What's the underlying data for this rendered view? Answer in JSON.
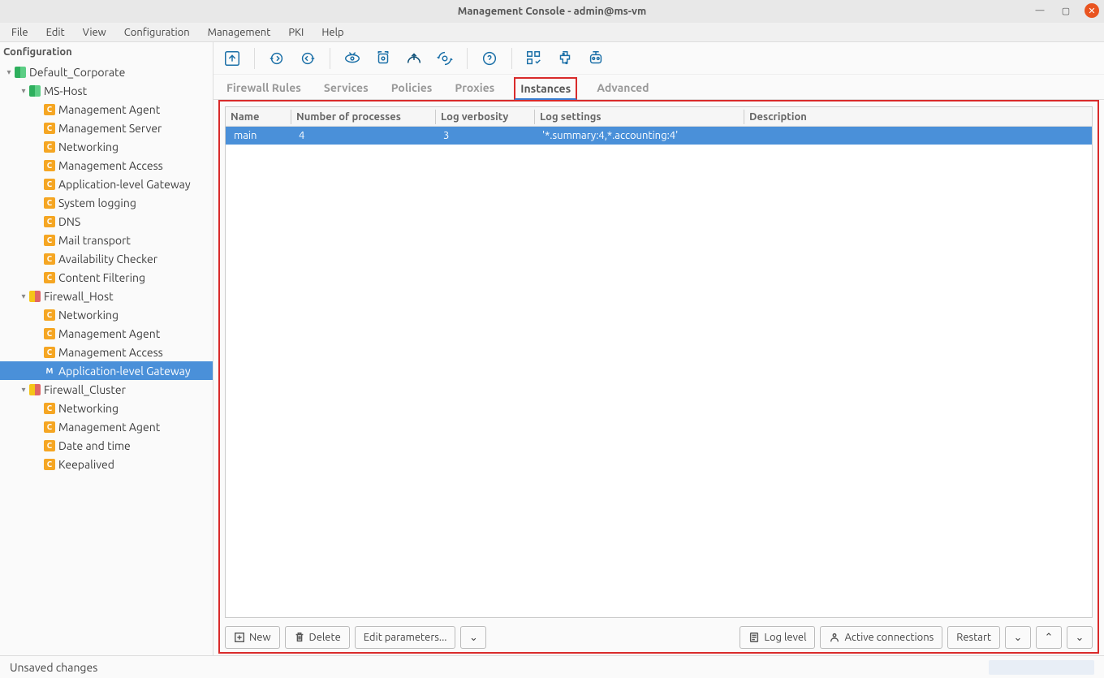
{
  "window": {
    "title": "Management Console - admin@ms-vm"
  },
  "menu": [
    "File",
    "Edit",
    "View",
    "Configuration",
    "Management",
    "PKI",
    "Help"
  ],
  "sidebar": {
    "title": "Configuration",
    "tree": [
      {
        "depth": 0,
        "caret": "▾",
        "icon": "dual-green",
        "label": "Default_Corporate"
      },
      {
        "depth": 1,
        "caret": "▾",
        "icon": "dual-green2",
        "label": "MS-Host"
      },
      {
        "depth": 2,
        "caret": "",
        "icon": "c",
        "label": "Management Agent"
      },
      {
        "depth": 2,
        "caret": "",
        "icon": "c",
        "label": "Management Server"
      },
      {
        "depth": 2,
        "caret": "",
        "icon": "c",
        "label": "Networking"
      },
      {
        "depth": 2,
        "caret": "",
        "icon": "c",
        "label": "Management Access"
      },
      {
        "depth": 2,
        "caret": "",
        "icon": "c",
        "label": "Application-level Gateway"
      },
      {
        "depth": 2,
        "caret": "",
        "icon": "c",
        "label": "System logging"
      },
      {
        "depth": 2,
        "caret": "",
        "icon": "c",
        "label": "DNS"
      },
      {
        "depth": 2,
        "caret": "",
        "icon": "c",
        "label": "Mail transport"
      },
      {
        "depth": 2,
        "caret": "",
        "icon": "c",
        "label": "Availability Checker"
      },
      {
        "depth": 2,
        "caret": "",
        "icon": "c",
        "label": "Content Filtering"
      },
      {
        "depth": 1,
        "caret": "▾",
        "icon": "dual-yr",
        "label": "Firewall_Host"
      },
      {
        "depth": 2,
        "caret": "",
        "icon": "c",
        "label": "Networking"
      },
      {
        "depth": 2,
        "caret": "",
        "icon": "c",
        "label": "Management Agent"
      },
      {
        "depth": 2,
        "caret": "",
        "icon": "c",
        "label": "Management Access"
      },
      {
        "depth": 2,
        "caret": "",
        "icon": "m",
        "label": "Application-level Gateway",
        "selected": true
      },
      {
        "depth": 1,
        "caret": "▾",
        "icon": "dual-yr",
        "label": "Firewall_Cluster"
      },
      {
        "depth": 2,
        "caret": "",
        "icon": "c",
        "label": "Networking"
      },
      {
        "depth": 2,
        "caret": "",
        "icon": "c",
        "label": "Management Agent"
      },
      {
        "depth": 2,
        "caret": "",
        "icon": "c",
        "label": "Date and time"
      },
      {
        "depth": 2,
        "caret": "",
        "icon": "c",
        "label": "Keepalived"
      }
    ]
  },
  "toolbar_icons": [
    "nav-back",
    "sync-in",
    "sync-out",
    "view-toggle",
    "gear-swap",
    "upload-gear",
    "gear-cycle",
    "help-cycle",
    "apps-check",
    "python-icon",
    "robot-icon"
  ],
  "tabs": [
    {
      "label": "Firewall Rules"
    },
    {
      "label": "Services"
    },
    {
      "label": "Policies"
    },
    {
      "label": "Proxies"
    },
    {
      "label": "Instances",
      "active": true
    },
    {
      "label": "Advanced"
    }
  ],
  "table": {
    "columns": [
      "Name",
      "Number of processes",
      "Log verbosity",
      "Log settings",
      "Description"
    ],
    "rows": [
      {
        "name": "main",
        "processes": "4",
        "verbosity": "3",
        "settings": "'*.summary:4,*.accounting:4'",
        "desc": "",
        "selected": true
      }
    ]
  },
  "actions": {
    "new": "New",
    "delete": "Delete",
    "edit": "Edit parameters...",
    "loglevel": "Log level",
    "active": "Active connections",
    "restart": "Restart"
  },
  "status": "Unsaved changes"
}
